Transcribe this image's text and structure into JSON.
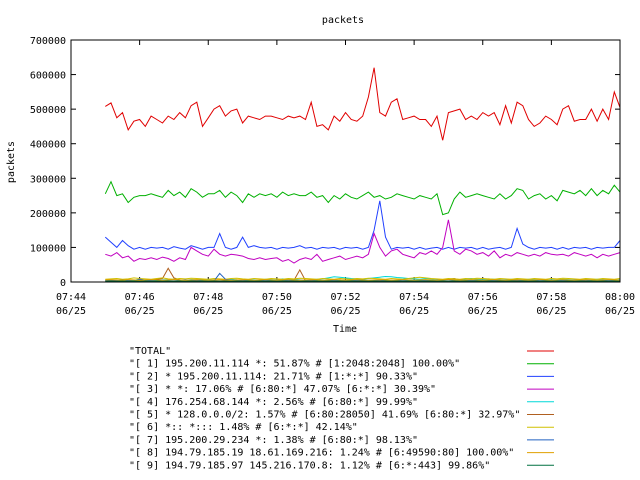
{
  "chart_data": {
    "type": "line",
    "title": "packets",
    "xlabel": "Time",
    "ylabel": "packets",
    "ylim": [
      0,
      700000
    ],
    "y_ticks": [
      0,
      100000,
      200000,
      300000,
      400000,
      500000,
      600000,
      700000
    ],
    "y_tick_labels": [
      "0",
      "100000",
      "200000",
      "300000",
      "400000",
      "500000",
      "600000",
      "700000"
    ],
    "xlim": [
      "07:44",
      "08:00"
    ],
    "x_ticks": [
      {
        "time": "07:44",
        "date": "06/25"
      },
      {
        "time": "07:46",
        "date": "06/25"
      },
      {
        "time": "07:48",
        "date": "06/25"
      },
      {
        "time": "07:50",
        "date": "06/25"
      },
      {
        "time": "07:52",
        "date": "06/25"
      },
      {
        "time": "07:54",
        "date": "06/25"
      },
      {
        "time": "07:56",
        "date": "06/25"
      },
      {
        "time": "07:58",
        "date": "06/25"
      },
      {
        "time": "08:00",
        "date": "06/25"
      }
    ],
    "grid": false,
    "legend_position": "bottom",
    "x": [
      "07:45:00",
      "07:45:10",
      "07:45:20",
      "07:45:30",
      "07:45:40",
      "07:45:50",
      "07:46:00",
      "07:46:10",
      "07:46:20",
      "07:46:30",
      "07:46:40",
      "07:46:50",
      "07:47:00",
      "07:47:10",
      "07:47:20",
      "07:47:30",
      "07:47:40",
      "07:47:50",
      "07:48:00",
      "07:48:10",
      "07:48:20",
      "07:48:30",
      "07:48:40",
      "07:48:50",
      "07:49:00",
      "07:49:10",
      "07:49:20",
      "07:49:30",
      "07:49:40",
      "07:49:50",
      "07:50:00",
      "07:50:10",
      "07:50:20",
      "07:50:30",
      "07:50:40",
      "07:50:50",
      "07:51:00",
      "07:51:10",
      "07:51:20",
      "07:51:30",
      "07:51:40",
      "07:51:50",
      "07:52:00",
      "07:52:10",
      "07:52:20",
      "07:52:30",
      "07:52:40",
      "07:52:50",
      "07:53:00",
      "07:53:10",
      "07:53:20",
      "07:53:30",
      "07:53:40",
      "07:53:50",
      "07:54:00",
      "07:54:10",
      "07:54:20",
      "07:54:30",
      "07:54:40",
      "07:54:50",
      "07:55:00",
      "07:55:10",
      "07:55:20",
      "07:55:30",
      "07:55:40",
      "07:55:50",
      "07:56:00",
      "07:56:10",
      "07:56:20",
      "07:56:30",
      "07:56:40",
      "07:56:50",
      "07:57:00",
      "07:57:10",
      "07:57:20",
      "07:57:30",
      "07:57:40",
      "07:57:50",
      "07:58:00",
      "07:58:10",
      "07:58:20",
      "07:58:30",
      "07:58:40",
      "07:58:50",
      "07:59:00",
      "07:59:10",
      "07:59:20",
      "07:59:30",
      "07:59:40",
      "07:59:50",
      "08:00:00"
    ],
    "series": [
      {
        "name": "\"TOTAL\"",
        "color": "#e00000",
        "values": [
          508000,
          518000,
          475000,
          490000,
          440000,
          465000,
          470000,
          450000,
          480000,
          470000,
          460000,
          480000,
          470000,
          490000,
          475000,
          510000,
          520000,
          450000,
          475000,
          500000,
          510000,
          480000,
          495000,
          500000,
          460000,
          480000,
          475000,
          470000,
          480000,
          480000,
          475000,
          470000,
          480000,
          475000,
          480000,
          470000,
          520000,
          450000,
          455000,
          440000,
          480000,
          465000,
          490000,
          470000,
          465000,
          480000,
          535000,
          620000,
          490000,
          480000,
          520000,
          530000,
          470000,
          475000,
          480000,
          470000,
          470000,
          450000,
          480000,
          410000,
          490000,
          495000,
          500000,
          470000,
          480000,
          470000,
          490000,
          480000,
          490000,
          455000,
          510000,
          460000,
          520000,
          510000,
          470000,
          450000,
          460000,
          480000,
          470000,
          455000,
          500000,
          510000,
          465000,
          470000,
          470000,
          500000,
          465000,
          500000,
          470000,
          550000,
          505000
        ]
      },
      {
        "name": "\"[ 1] 195.200.11.114 *: 51.87% # [1:2048:2048] 100.00%\"",
        "color": "#00b000",
        "values": [
          255000,
          290000,
          250000,
          255000,
          230000,
          245000,
          250000,
          250000,
          255000,
          250000,
          245000,
          265000,
          250000,
          260000,
          245000,
          270000,
          260000,
          245000,
          255000,
          255000,
          265000,
          245000,
          260000,
          250000,
          230000,
          255000,
          245000,
          255000,
          250000,
          255000,
          245000,
          260000,
          250000,
          255000,
          250000,
          250000,
          260000,
          245000,
          250000,
          230000,
          250000,
          240000,
          255000,
          245000,
          240000,
          250000,
          260000,
          245000,
          250000,
          240000,
          245000,
          255000,
          250000,
          245000,
          240000,
          250000,
          245000,
          240000,
          255000,
          195000,
          200000,
          240000,
          260000,
          245000,
          250000,
          255000,
          250000,
          245000,
          240000,
          255000,
          240000,
          250000,
          270000,
          265000,
          240000,
          250000,
          255000,
          240000,
          250000,
          235000,
          265000,
          260000,
          255000,
          265000,
          250000,
          270000,
          250000,
          265000,
          255000,
          280000,
          260000
        ]
      },
      {
        "name": "\"[ 2] * 195.200.11.114: 21.71% # [1:*:*] 90.33%\"",
        "color": "#2040ff",
        "values": [
          130000,
          115000,
          100000,
          120000,
          105000,
          95000,
          100000,
          95000,
          100000,
          98000,
          100000,
          95000,
          102000,
          98000,
          95000,
          105000,
          100000,
          95000,
          100000,
          100000,
          140000,
          100000,
          95000,
          100000,
          130000,
          100000,
          105000,
          100000,
          98000,
          100000,
          95000,
          100000,
          98000,
          100000,
          105000,
          98000,
          100000,
          95000,
          100000,
          98000,
          100000,
          95000,
          100000,
          98000,
          100000,
          95000,
          100000,
          150000,
          235000,
          130000,
          95000,
          100000,
          98000,
          100000,
          95000,
          100000,
          95000,
          98000,
          100000,
          95000,
          100000,
          95000,
          100000,
          98000,
          100000,
          95000,
          100000,
          95000,
          98000,
          100000,
          95000,
          100000,
          155000,
          110000,
          100000,
          95000,
          100000,
          98000,
          100000,
          95000,
          100000,
          95000,
          100000,
          98000,
          100000,
          95000,
          100000,
          98000,
          100000,
          100000,
          120000
        ]
      },
      {
        "name": "\"[ 3] * *: 17.06% # [6:80:*] 47.07% [6:*:*] 30.39%\"",
        "color": "#c000c0",
        "values": [
          80000,
          75000,
          85000,
          70000,
          75000,
          60000,
          68000,
          65000,
          70000,
          65000,
          72000,
          68000,
          60000,
          70000,
          65000,
          100000,
          90000,
          80000,
          75000,
          95000,
          80000,
          75000,
          80000,
          78000,
          75000,
          68000,
          65000,
          70000,
          65000,
          68000,
          70000,
          60000,
          65000,
          55000,
          65000,
          70000,
          65000,
          80000,
          60000,
          65000,
          70000,
          75000,
          65000,
          70000,
          75000,
          70000,
          80000,
          140000,
          100000,
          75000,
          90000,
          95000,
          80000,
          75000,
          70000,
          85000,
          80000,
          90000,
          80000,
          100000,
          180000,
          90000,
          80000,
          95000,
          90000,
          80000,
          85000,
          75000,
          90000,
          70000,
          80000,
          75000,
          85000,
          80000,
          75000,
          80000,
          75000,
          85000,
          80000,
          78000,
          80000,
          75000,
          85000,
          80000,
          75000,
          80000,
          70000,
          80000,
          75000,
          80000,
          85000
        ]
      },
      {
        "name": "\"[ 4] 176.254.68.144 *: 2.56% # [6:80:*] 99.99%\"",
        "color": "#00d8d8",
        "values": [
          5000,
          6000,
          5000,
          7000,
          6000,
          5000,
          8000,
          6000,
          7000,
          5000,
          6000,
          7000,
          8000,
          6000,
          5000,
          7000,
          6000,
          8000,
          7000,
          6000,
          5000,
          7000,
          8000,
          6000,
          5000,
          7000,
          6000,
          5000,
          8000,
          7000,
          6000,
          9000,
          7000,
          8000,
          6000,
          5000,
          7000,
          8000,
          9000,
          12000,
          15000,
          14000,
          12000,
          10000,
          9000,
          8000,
          10000,
          12000,
          14000,
          16000,
          15000,
          13000,
          12000,
          10000,
          9000,
          8000,
          10000,
          9000,
          8000,
          7000,
          9000,
          8000,
          7000,
          9000,
          10000,
          8000,
          7000,
          9000,
          8000,
          7000,
          6000,
          8000,
          7000,
          6000,
          8000,
          7000,
          6000,
          5000,
          7000,
          6000,
          8000,
          7000,
          6000,
          5000,
          7000,
          6000,
          8000,
          7000,
          6000,
          5000,
          7000
        ]
      },
      {
        "name": "\"[ 5] * 128.0.0.0/2: 1.57% # [6:80:28050] 41.69% [6:80:*] 32.97%\"",
        "color": "#b06020",
        "values": [
          4000,
          5000,
          4000,
          6000,
          5000,
          3000,
          4000,
          5000,
          6000,
          8000,
          10000,
          40000,
          12000,
          6000,
          5000,
          4000,
          6000,
          5000,
          4000,
          5000,
          6000,
          4000,
          5000,
          6000,
          4000,
          5000,
          4000,
          6000,
          5000,
          4000,
          5000,
          6000,
          4000,
          5000,
          35000,
          4000,
          5000,
          6000,
          4000,
          5000,
          4000,
          6000,
          5000,
          4000,
          5000,
          6000,
          4000,
          5000,
          6000,
          4000,
          5000,
          4000,
          6000,
          5000,
          4000,
          5000,
          6000,
          4000,
          5000,
          6000,
          8000,
          10000,
          6000,
          5000,
          4000,
          6000,
          5000,
          4000,
          5000,
          6000,
          4000,
          5000,
          6000,
          4000,
          5000,
          4000,
          6000,
          5000,
          4000,
          5000,
          6000,
          4000,
          5000,
          6000,
          4000,
          5000,
          4000,
          6000,
          5000,
          4000,
          5000
        ]
      },
      {
        "name": "\"[ 6] *:: *::: 1.48% # [6:*:*] 42.14%\"",
        "color": "#d0c000",
        "values": [
          8000,
          9000,
          10000,
          8000,
          9000,
          12000,
          10000,
          9000,
          8000,
          10000,
          12000,
          9000,
          8000,
          10000,
          9000,
          11000,
          10000,
          9000,
          8000,
          10000,
          9000,
          8000,
          10000,
          11000,
          9000,
          8000,
          10000,
          9000,
          8000,
          10000,
          9000,
          8000,
          10000,
          9000,
          11000,
          10000,
          9000,
          8000,
          10000,
          9000,
          8000,
          10000,
          9000,
          8000,
          10000,
          9000,
          11000,
          10000,
          9000,
          8000,
          10000,
          9000,
          8000,
          10000,
          12000,
          14000,
          12000,
          10000,
          9000,
          8000,
          10000,
          9000,
          8000,
          10000,
          9000,
          11000,
          10000,
          9000,
          8000,
          10000,
          9000,
          8000,
          10000,
          9000,
          8000,
          10000,
          9000,
          8000,
          10000,
          9000,
          11000,
          10000,
          9000,
          8000,
          10000,
          9000,
          8000,
          10000,
          9000,
          8000,
          10000
        ]
      },
      {
        "name": "\"[ 7] 195.200.29.234 *: 1.38% # [6:80:*] 98.13%\"",
        "color": "#2060c0",
        "values": [
          3000,
          4000,
          3000,
          5000,
          4000,
          3000,
          8000,
          5000,
          4000,
          3000,
          5000,
          4000,
          3000,
          5000,
          6000,
          4000,
          3000,
          5000,
          4000,
          3000,
          25000,
          8000,
          5000,
          4000,
          3000,
          5000,
          4000,
          3000,
          5000,
          4000,
          3000,
          5000,
          4000,
          3000,
          5000,
          4000,
          3000,
          5000,
          4000,
          3000,
          5000,
          4000,
          3000,
          5000,
          4000,
          3000,
          5000,
          4000,
          3000,
          5000,
          4000,
          3000,
          5000,
          4000,
          3000,
          5000,
          4000,
          3000,
          5000,
          4000,
          3000,
          5000,
          4000,
          3000,
          5000,
          4000,
          3000,
          5000,
          4000,
          3000,
          5000,
          4000,
          3000,
          5000,
          4000,
          3000,
          5000,
          4000,
          3000,
          5000,
          4000,
          3000,
          5000,
          4000,
          3000,
          5000,
          4000,
          3000,
          5000,
          4000,
          3000
        ]
      },
      {
        "name": "\"[ 8] 194.79.185.19 18.61.169.216: 1.24% # [6:49590:80] 100.00%\"",
        "color": "#e0a000",
        "values": [
          6000,
          7000,
          6000,
          5000,
          7000,
          6000,
          5000,
          6000,
          7000,
          6000,
          5000,
          6000,
          7000,
          6000,
          5000,
          6000,
          7000,
          6000,
          5000,
          6000,
          7000,
          6000,
          5000,
          6000,
          7000,
          6000,
          5000,
          6000,
          7000,
          6000,
          5000,
          6000,
          7000,
          6000,
          5000,
          6000,
          7000,
          6000,
          5000,
          6000,
          7000,
          6000,
          5000,
          6000,
          7000,
          6000,
          5000,
          6000,
          7000,
          6000,
          5000,
          6000,
          7000,
          6000,
          5000,
          6000,
          7000,
          6000,
          5000,
          6000,
          7000,
          6000,
          5000,
          6000,
          7000,
          6000,
          5000,
          6000,
          7000,
          6000,
          5000,
          6000,
          7000,
          6000,
          5000,
          6000,
          7000,
          6000,
          5000,
          6000,
          7000,
          6000,
          5000,
          6000,
          7000,
          6000,
          5000,
          6000,
          7000,
          6000,
          5000
        ]
      },
      {
        "name": "\"[ 9] 194.79.185.97 145.216.170.8: 1.12% # [6:*:443] 99.86%\"",
        "color": "#007040",
        "values": [
          2000,
          3000,
          2000,
          3000,
          2000,
          3000,
          2000,
          3000,
          2000,
          3000,
          2000,
          3000,
          2000,
          3000,
          2000,
          3000,
          2000,
          3000,
          2000,
          3000,
          2000,
          3000,
          2000,
          3000,
          2000,
          3000,
          2000,
          3000,
          2000,
          3000,
          2000,
          3000,
          2000,
          3000,
          2000,
          3000,
          2000,
          3000,
          2000,
          3000,
          2000,
          3000,
          2000,
          3000,
          2000,
          3000,
          2000,
          3000,
          2000,
          3000,
          2000,
          3000,
          2000,
          3000,
          2000,
          3000,
          2000,
          3000,
          2000,
          3000,
          2000,
          3000,
          2000,
          3000,
          2000,
          3000,
          2000,
          3000,
          2000,
          3000,
          2000,
          3000,
          2000,
          3000,
          2000,
          3000,
          2000,
          3000,
          2000,
          3000,
          2000,
          3000,
          2000,
          3000,
          2000,
          3000,
          2000,
          3000,
          2000,
          3000,
          2000
        ]
      }
    ]
  }
}
